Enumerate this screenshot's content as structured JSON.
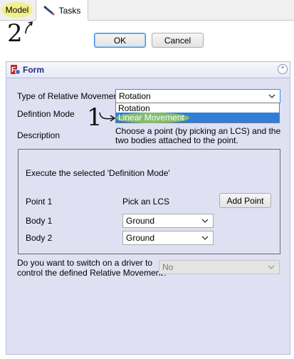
{
  "tabs": {
    "model_label": "Model",
    "tasks_label": "Tasks"
  },
  "annotations": {
    "step2": "2",
    "step1": "1"
  },
  "dialog": {
    "ok_label": "OK",
    "cancel_label": "Cancel"
  },
  "panel": {
    "title": "Form",
    "relative_movement_label": "Type of Relative Movement",
    "relative_movement_value": "Rotation",
    "relative_movement_options": [
      "Rotation",
      "Linear Movement"
    ],
    "definition_mode_label": "Defintion Mode",
    "description_label": "Description",
    "description_text_line1": "Choose a point (by picking an LCS) and the",
    "description_text_line2": "two bodies attached to the point.",
    "execute_text": "Execute the selected 'Definition Mode'",
    "point1_label": "Point 1",
    "point1_hint": "Pick an LCS",
    "add_point_label": "Add Point",
    "body1_label": "Body 1",
    "body1_value": "Ground",
    "body2_label": "Body 2",
    "body2_value": "Ground",
    "driver_question_line1": "Do you want to switch on a driver to",
    "driver_question_line2": "control the defined Relative Movement?",
    "driver_value": "No"
  },
  "colors": {
    "panel_bg": "#dfe1f3",
    "selection": "#2f7ed8",
    "model_highlight": "#f4ef7a",
    "option_highlight": "#9fd24f"
  },
  "icons": [
    "wrench-pencil-icon",
    "freecad-form-icon",
    "collapse-icon",
    "chevron-down-icon"
  ]
}
